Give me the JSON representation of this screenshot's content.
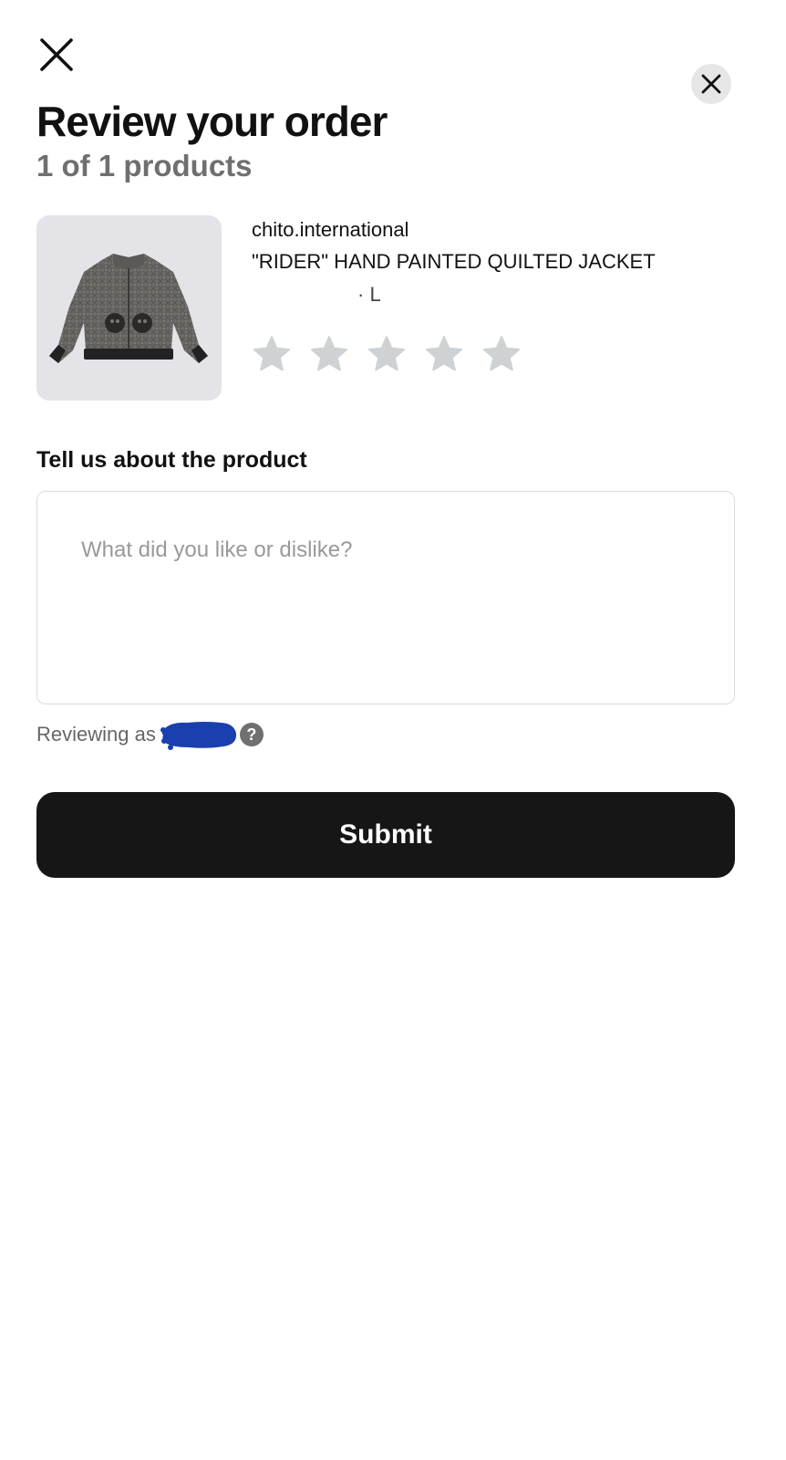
{
  "header": {
    "close_icon": "close-icon",
    "dismiss_icon": "close-circle-icon",
    "title": "Review your order",
    "subtitle": "1 of 1 products"
  },
  "product": {
    "image_icon": "quilted-jacket-image",
    "shop_name": "chito.international",
    "name": "\"RIDER\" HAND PAINTED QUILTED JACKET",
    "variant": "· L",
    "rating": {
      "max": 5,
      "selected": 0,
      "star_color": "#cfd2d4"
    }
  },
  "review": {
    "heading": "Tell us about the product",
    "value": "",
    "placeholder": "What did you like or dislike?",
    "reviewing_as_label": "Reviewing as",
    "redaction_color": "#1a3fae",
    "help_icon": "help-circle-icon",
    "help_glyph": "?"
  },
  "actions": {
    "submit_label": "Submit"
  },
  "colors": {
    "primary_button": "#161616",
    "secondary_text": "#6f6f6f"
  }
}
